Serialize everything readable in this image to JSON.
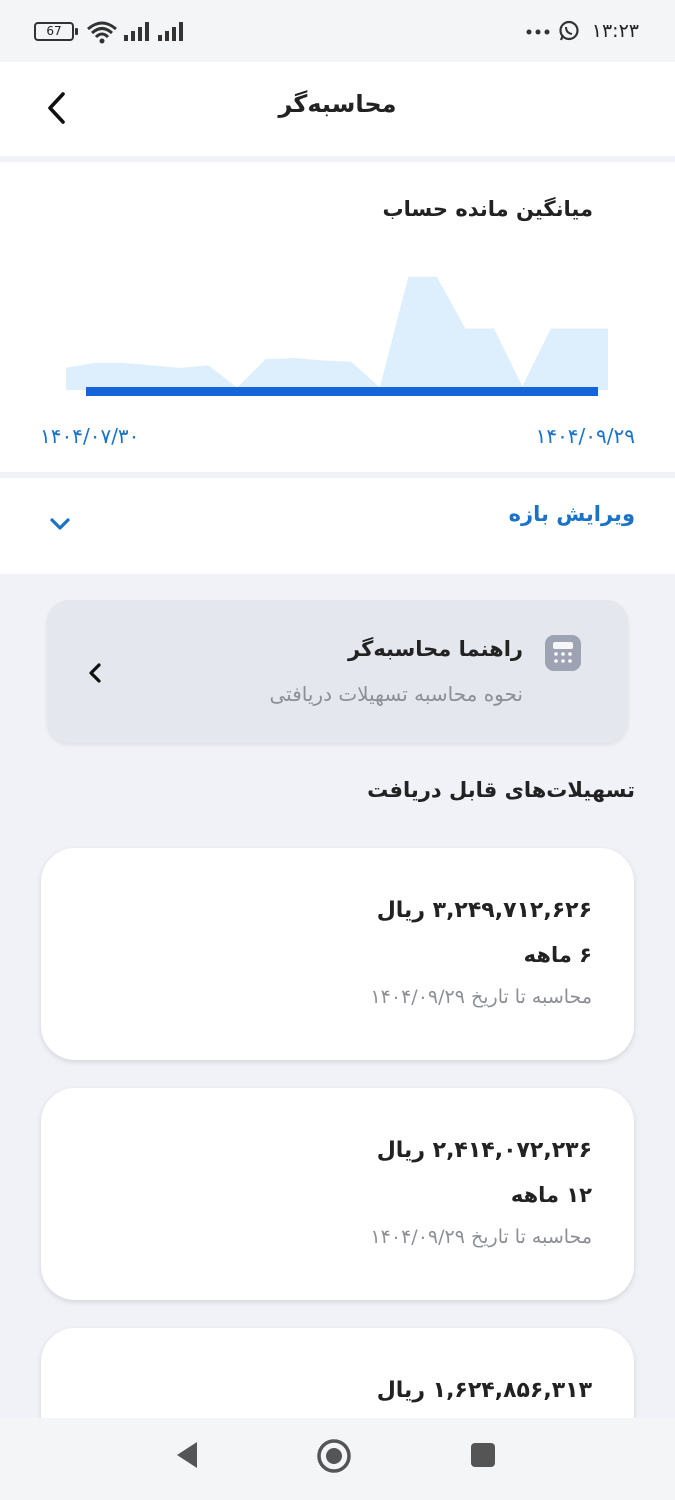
{
  "status_bar": {
    "battery": "67",
    "time": "۱۳:۲۳",
    "icons": [
      "wifi-icon",
      "signal-icon",
      "signal-icon",
      "more-dots-icon",
      "whatsapp-icon"
    ]
  },
  "header": {
    "title": "محاسبه‌گر",
    "back_icon": "chevron-left-icon"
  },
  "chart": {
    "title": "میانگین مانده حساب",
    "start_date": "۱۴۰۴/۰۷/۳۰",
    "end_date": "۱۴۰۴/۰۹/۲۹",
    "area_color": "#ddeefc",
    "line_color": "#1565d8"
  },
  "chart_data": {
    "type": "area",
    "x": [
      "۱۴۰۴/۰۷/۳۰",
      "۱۴۰۴/۰۹/۲۹"
    ],
    "series": [
      {
        "values": [
          0.18,
          0.22,
          0.22,
          0.2,
          0.18,
          0.2,
          0.02,
          0.25,
          0.26,
          0.24,
          0.23,
          0.02,
          0.92,
          0.92,
          0.5,
          0.5,
          0.03,
          0.5,
          0.5,
          0.5
        ]
      }
    ]
  },
  "edit_range": {
    "label": "ویرایش بازه",
    "icon": "chevron-down-icon"
  },
  "guide": {
    "title": "راهنما محاسبه‌گر",
    "subtitle": "نحوه محاسبه تسهیلات دریافتی",
    "icon": "calculator-icon"
  },
  "section_title": "تسهیلات‌های قابل دریافت",
  "loans": [
    {
      "amount": "۳,۲۴۹,۷۱۲,۶۲۶ ریال",
      "duration": "۶ ماهه",
      "calc": "محاسبه تا تاریخ ۱۴۰۴/۰۹/۲۹"
    },
    {
      "amount": "۲,۴۱۴,۰۷۲,۲۳۶ ریال",
      "duration": "۱۲ ماهه",
      "calc": "محاسبه تا تاریخ ۱۴۰۴/۰۹/۲۹"
    },
    {
      "amount": "۱,۶۲۴,۸۵۶,۳۱۳ ریال",
      "duration": "",
      "calc": ""
    }
  ],
  "nav": [
    "back-triangle-icon",
    "home-circle-icon",
    "recents-square-icon"
  ]
}
